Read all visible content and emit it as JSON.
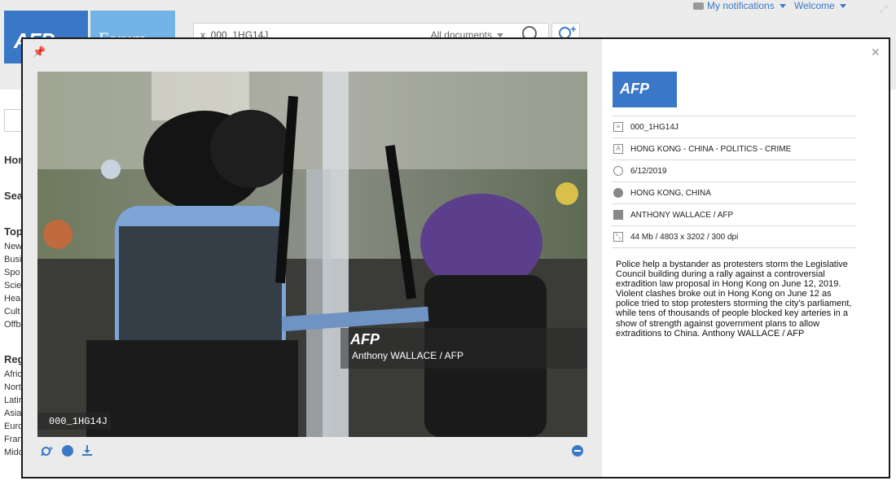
{
  "header": {
    "logo_afp": "AFP",
    "logo_forum": "Forum",
    "search": {
      "value": "x_000_1HG14J",
      "scope": "All documents"
    },
    "notifications_label": "My notifications",
    "welcome_label": "Welcome"
  },
  "sidebar": {
    "home": "Hom",
    "search": "Sea",
    "topics_heading": "Top",
    "topics": [
      "New",
      "Busi",
      "Spo",
      "Scie",
      "Hea",
      "Cult",
      "Offb"
    ],
    "regions_heading": "Reg",
    "regions": [
      "Afric",
      "Nort",
      "Latir",
      "Asia",
      "Euro",
      "Fran",
      "Midc"
    ]
  },
  "photo": {
    "watermark_logo": "AFP",
    "watermark_credit": "Anthony WALLACE / AFP",
    "id_tag": "000_1HG14J"
  },
  "info": {
    "logo": "AFP",
    "rows": [
      {
        "icon": "document-icon",
        "value": "000_1HG14J"
      },
      {
        "icon": "text-icon",
        "value": "HONG KONG - CHINA - POLITICS - CRIME"
      },
      {
        "icon": "clock-icon",
        "value": "6/12/2019"
      },
      {
        "icon": "globe-icon",
        "value": "HONG KONG, CHINA"
      },
      {
        "icon": "camera-icon",
        "value": "ANTHONY WALLACE / AFP"
      },
      {
        "icon": "resize-icon",
        "value": "44 Mb / 4803 x 3202 / 300 dpi"
      }
    ],
    "caption": "Police help a bystander as protesters storm the Legislative Council building during a rally against a controversial extradition law proposal in Hong Kong on June 12, 2019. Violent clashes broke out in Hong Kong on June 12 as police tried to stop protesters storming the city's parliament, while tens of thousands of people blocked key arteries in a show of strength against government plans to allow extraditions to China. Anthony WALLACE / AFP"
  },
  "colors": {
    "accent": "#3a78c7",
    "forum": "#73b3e6",
    "modal_border": "#1a1a1a"
  }
}
